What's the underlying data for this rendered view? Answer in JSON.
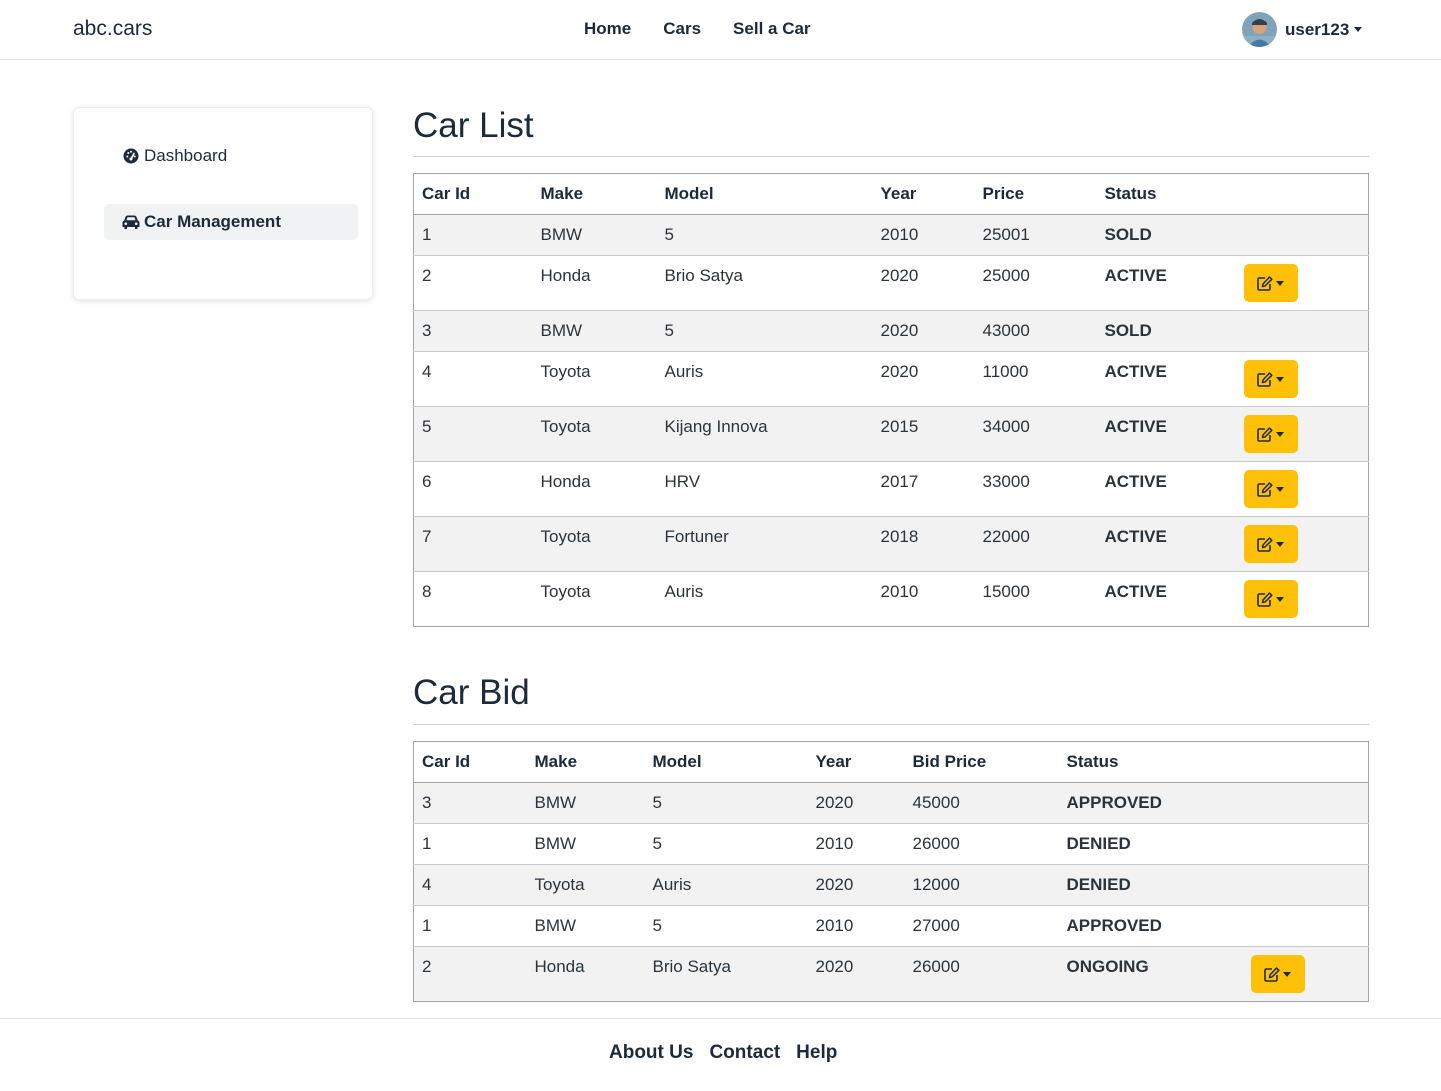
{
  "navbar": {
    "brand": "abc.cars",
    "links": [
      "Home",
      "Cars",
      "Sell a Car"
    ],
    "user": "user123"
  },
  "sidebar": {
    "items": [
      {
        "label": "Dashboard",
        "icon": "gauge-icon"
      },
      {
        "label": "Car Management",
        "icon": "car-icon",
        "active": true
      }
    ]
  },
  "car_list": {
    "title": "Car List",
    "headers": [
      "Car Id",
      "Make",
      "Model",
      "Year",
      "Price",
      "Status"
    ],
    "rows": [
      {
        "id": "1",
        "make": "BMW",
        "model": "5",
        "year": "2010",
        "price": "25001",
        "status": "SOLD"
      },
      {
        "id": "2",
        "make": "Honda",
        "model": "Brio Satya",
        "year": "2020",
        "price": "25000",
        "status": "ACTIVE"
      },
      {
        "id": "3",
        "make": "BMW",
        "model": "5",
        "year": "2020",
        "price": "43000",
        "status": "SOLD"
      },
      {
        "id": "4",
        "make": "Toyota",
        "model": "Auris",
        "year": "2020",
        "price": "11000",
        "status": "ACTIVE"
      },
      {
        "id": "5",
        "make": "Toyota",
        "model": "Kijang Innova",
        "year": "2015",
        "price": "34000",
        "status": "ACTIVE"
      },
      {
        "id": "6",
        "make": "Honda",
        "model": "HRV",
        "year": "2017",
        "price": "33000",
        "status": "ACTIVE"
      },
      {
        "id": "7",
        "make": "Toyota",
        "model": "Fortuner",
        "year": "2018",
        "price": "22000",
        "status": "ACTIVE"
      },
      {
        "id": "8",
        "make": "Toyota",
        "model": "Auris",
        "year": "2010",
        "price": "15000",
        "status": "ACTIVE"
      }
    ]
  },
  "car_bid": {
    "title": "Car Bid",
    "headers": [
      "Car Id",
      "Make",
      "Model",
      "Year",
      "Bid Price",
      "Status"
    ],
    "rows": [
      {
        "id": "3",
        "make": "BMW",
        "model": "5",
        "year": "2020",
        "bid_price": "45000",
        "status": "APPROVED"
      },
      {
        "id": "1",
        "make": "BMW",
        "model": "5",
        "year": "2010",
        "bid_price": "26000",
        "status": "DENIED"
      },
      {
        "id": "4",
        "make": "Toyota",
        "model": "Auris",
        "year": "2020",
        "bid_price": "12000",
        "status": "DENIED"
      },
      {
        "id": "1",
        "make": "BMW",
        "model": "5",
        "year": "2010",
        "bid_price": "27000",
        "status": "APPROVED"
      },
      {
        "id": "2",
        "make": "Honda",
        "model": "Brio Satya",
        "year": "2020",
        "bid_price": "26000",
        "status": "ONGOING"
      }
    ]
  },
  "footer": {
    "links": [
      "About Us",
      "Contact",
      "Help"
    ]
  },
  "colors": {
    "action_button": "#ffc107",
    "status_success": "#198754",
    "status_info": "#0d6efd",
    "status_danger": "#dc3545"
  }
}
